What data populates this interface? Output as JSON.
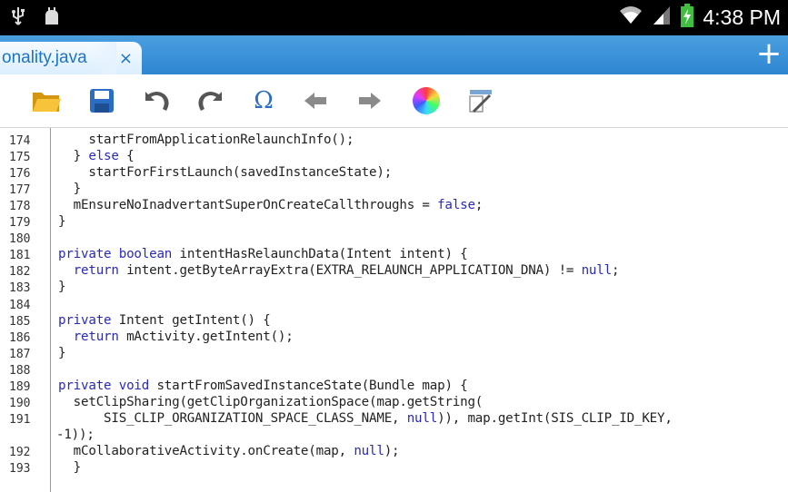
{
  "status_bar": {
    "time": "4:38 PM",
    "icons": [
      "usb-icon",
      "android-icon",
      "wifi-icon",
      "signal-icon",
      "battery-charging-icon"
    ]
  },
  "tabs": [
    {
      "label": "onality.java",
      "close": "×"
    }
  ],
  "add_tab": "+",
  "toolbar": {
    "buttons": [
      "open-folder-icon",
      "save-icon",
      "undo-icon",
      "redo-icon",
      "special-chars-icon",
      "back-arrow-icon",
      "forward-arrow-icon",
      "color-picker-icon",
      "settings-icon"
    ],
    "omega_label": "Ω"
  },
  "colors": {
    "tab_bar": "#3b93da",
    "tab_text": "#1a74c8",
    "keyword": "#2a2ab8",
    "folder": "#f2b319",
    "save": "#2b6cc4"
  },
  "editor": {
    "lines": [
      {
        "num": "174",
        "code": "    startFromApplicationRelaunchInfo();"
      },
      {
        "num": "175",
        "code": "  } else {"
      },
      {
        "num": "176",
        "code": "    startForFirstLaunch(savedInstanceState);"
      },
      {
        "num": "177",
        "code": "  }"
      },
      {
        "num": "178",
        "code": "  mEnsureNoInadvertantSuperOnCreateCallthroughs = false;"
      },
      {
        "num": "179",
        "code": "}"
      },
      {
        "num": "180",
        "code": ""
      },
      {
        "num": "181",
        "code": "private boolean intentHasRelaunchData(Intent intent) {"
      },
      {
        "num": "182",
        "code": "  return intent.getByteArrayExtra(EXTRA_RELAUNCH_APPLICATION_DNA) != null;"
      },
      {
        "num": "183",
        "code": "}"
      },
      {
        "num": "184",
        "code": ""
      },
      {
        "num": "185",
        "code": "private Intent getIntent() {"
      },
      {
        "num": "186",
        "code": "  return mActivity.getIntent();"
      },
      {
        "num": "187",
        "code": "}"
      },
      {
        "num": "188",
        "code": ""
      },
      {
        "num": "189",
        "code": "private void startFromSavedInstanceState(Bundle map) {"
      },
      {
        "num": "190",
        "code": "  setClipSharing(getClipOrganizationSpace(map.getString("
      },
      {
        "num": "191",
        "code": "      SIS_CLIP_ORGANIZATION_SPACE_CLASS_NAME, null)), map.getInt(SIS_CLIP_ID_KEY,"
      },
      {
        "num": "",
        "code": "-1));"
      },
      {
        "num": "192",
        "code": "  mCollaborativeActivity.onCreate(map, null);"
      },
      {
        "num": "193",
        "code": "  }"
      }
    ]
  }
}
